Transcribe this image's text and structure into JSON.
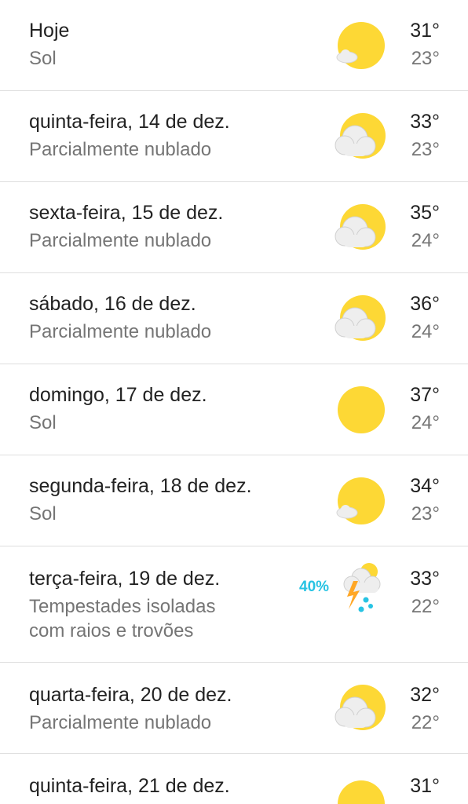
{
  "forecast": {
    "days": [
      {
        "day": "Hoje",
        "condition": "Sol",
        "condition_line2": "",
        "high": "31°",
        "low": "23°",
        "icon": "sun-small-cloud-icon",
        "precip": ""
      },
      {
        "day": "quinta-feira, 14 de dez.",
        "condition": "Parcialmente nublado",
        "condition_line2": "",
        "high": "33°",
        "low": "23°",
        "icon": "partly-cloudy-icon",
        "precip": ""
      },
      {
        "day": "sexta-feira, 15 de dez.",
        "condition": "Parcialmente nublado",
        "condition_line2": "",
        "high": "35°",
        "low": "24°",
        "icon": "partly-cloudy-icon",
        "precip": ""
      },
      {
        "day": "sábado, 16 de dez.",
        "condition": "Parcialmente nublado",
        "condition_line2": "",
        "high": "36°",
        "low": "24°",
        "icon": "partly-cloudy-icon",
        "precip": ""
      },
      {
        "day": "domingo, 17 de dez.",
        "condition": "Sol",
        "condition_line2": "",
        "high": "37°",
        "low": "24°",
        "icon": "sun-icon",
        "precip": ""
      },
      {
        "day": "segunda-feira, 18 de dez.",
        "condition": "Sol",
        "condition_line2": "",
        "high": "34°",
        "low": "23°",
        "icon": "sun-small-cloud-icon",
        "precip": ""
      },
      {
        "day": "terça-feira, 19 de dez.",
        "condition": "Tempestades isoladas",
        "condition_line2": "com raios e trovões",
        "high": "33°",
        "low": "22°",
        "icon": "thunderstorm-icon",
        "precip": "40%"
      },
      {
        "day": "quarta-feira, 20 de dez.",
        "condition": "Parcialmente nublado",
        "condition_line2": "",
        "high": "32°",
        "low": "22°",
        "icon": "partly-cloudy-icon",
        "precip": ""
      },
      {
        "day": "quinta-feira, 21 de dez.",
        "condition": "",
        "condition_line2": "",
        "high": "31°",
        "low": "",
        "icon": "sun-icon",
        "precip": ""
      }
    ]
  },
  "colors": {
    "sun": "#fdd835",
    "cloud": "#eeeeee",
    "precip": "#27c3e3",
    "lightning": "#ffa726",
    "divider": "#dedede"
  }
}
